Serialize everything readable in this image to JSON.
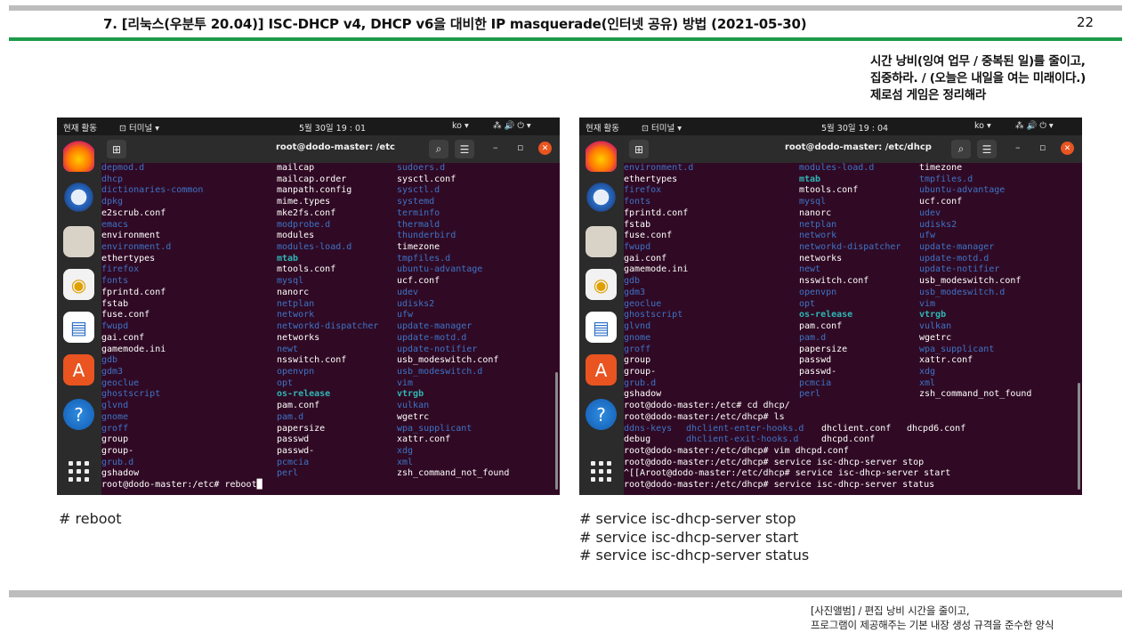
{
  "page": {
    "title": "7. [리눅스(우분투 20.04)] ISC-DHCP v4, DHCP v6을 대비한 IP masquerade(인터넷 공유) 방법 (2021-05-30)",
    "page_number": "22",
    "motto": [
      "시간 낭비(잉여 업무 / 중복된 일)를 줄이고,",
      "집중하라. / (오늘은 내일을 여는 미래이다.)",
      "제로섬 게임은 정리해라"
    ],
    "footer": [
      "[사진앨범] / 편집 낭비 시간을 줄이고,",
      "프로그램이 제공해주는 기본 내장 생성 규격을 준수한 양식"
    ]
  },
  "shots": [
    {
      "topbar": {
        "activities": "현재 활동",
        "app_menu": "⊡ 터미널 ▾",
        "clock": "5월 30일  19 : 01",
        "lang": "ko ▾",
        "sys_icons": "⁂  🔊  ⏻  ▾"
      },
      "window_title": "root@dodo-master: /etc",
      "lines": [
        [
          {
            "t": "depmod.d",
            "c": "dir"
          },
          {
            "t": "mailcap",
            "c": "plain"
          },
          {
            "t": "sudoers.d",
            "c": "dir"
          }
        ],
        [
          {
            "t": "dhcp",
            "c": "dir"
          },
          {
            "t": "mailcap.order",
            "c": "plain"
          },
          {
            "t": "sysctl.conf",
            "c": "plain"
          }
        ],
        [
          {
            "t": "dictionaries-common",
            "c": "dir"
          },
          {
            "t": "manpath.config",
            "c": "plain"
          },
          {
            "t": "sysctl.d",
            "c": "dir"
          }
        ],
        [
          {
            "t": "dpkg",
            "c": "dir"
          },
          {
            "t": "mime.types",
            "c": "plain"
          },
          {
            "t": "systemd",
            "c": "dir"
          }
        ],
        [
          {
            "t": "e2scrub.conf",
            "c": "plain"
          },
          {
            "t": "mke2fs.conf",
            "c": "plain"
          },
          {
            "t": "terminfo",
            "c": "dir"
          }
        ],
        [
          {
            "t": "emacs",
            "c": "dir"
          },
          {
            "t": "modprobe.d",
            "c": "dir"
          },
          {
            "t": "thermald",
            "c": "dir"
          }
        ],
        [
          {
            "t": "environment",
            "c": "plain"
          },
          {
            "t": "modules",
            "c": "plain"
          },
          {
            "t": "thunderbird",
            "c": "dir"
          }
        ],
        [
          {
            "t": "environment.d",
            "c": "dir"
          },
          {
            "t": "modules-load.d",
            "c": "dir"
          },
          {
            "t": "timezone",
            "c": "plain"
          }
        ],
        [
          {
            "t": "ethertypes",
            "c": "plain"
          },
          {
            "t": "mtab",
            "c": "link"
          },
          {
            "t": "tmpfiles.d",
            "c": "dir"
          }
        ],
        [
          {
            "t": "firefox",
            "c": "dir"
          },
          {
            "t": "mtools.conf",
            "c": "plain"
          },
          {
            "t": "ubuntu-advantage",
            "c": "dir"
          }
        ],
        [
          {
            "t": "fonts",
            "c": "dir"
          },
          {
            "t": "mysql",
            "c": "dir"
          },
          {
            "t": "ucf.conf",
            "c": "plain"
          }
        ],
        [
          {
            "t": "fprintd.conf",
            "c": "plain"
          },
          {
            "t": "nanorc",
            "c": "plain"
          },
          {
            "t": "udev",
            "c": "dir"
          }
        ],
        [
          {
            "t": "fstab",
            "c": "plain"
          },
          {
            "t": "netplan",
            "c": "dir"
          },
          {
            "t": "udisks2",
            "c": "dir"
          }
        ],
        [
          {
            "t": "fuse.conf",
            "c": "plain"
          },
          {
            "t": "network",
            "c": "dir"
          },
          {
            "t": "ufw",
            "c": "dir"
          }
        ],
        [
          {
            "t": "fwupd",
            "c": "dir"
          },
          {
            "t": "networkd-dispatcher",
            "c": "dir"
          },
          {
            "t": "update-manager",
            "c": "dir"
          }
        ],
        [
          {
            "t": "gai.conf",
            "c": "plain"
          },
          {
            "t": "networks",
            "c": "plain"
          },
          {
            "t": "update-motd.d",
            "c": "dir"
          }
        ],
        [
          {
            "t": "gamemode.ini",
            "c": "plain"
          },
          {
            "t": "newt",
            "c": "dir"
          },
          {
            "t": "update-notifier",
            "c": "dir"
          }
        ],
        [
          {
            "t": "gdb",
            "c": "dir"
          },
          {
            "t": "nsswitch.conf",
            "c": "plain"
          },
          {
            "t": "usb_modeswitch.conf",
            "c": "plain"
          }
        ],
        [
          {
            "t": "gdm3",
            "c": "dir"
          },
          {
            "t": "openvpn",
            "c": "dir"
          },
          {
            "t": "usb_modeswitch.d",
            "c": "dir"
          }
        ],
        [
          {
            "t": "geoclue",
            "c": "dir"
          },
          {
            "t": "opt",
            "c": "dir"
          },
          {
            "t": "vim",
            "c": "dir"
          }
        ],
        [
          {
            "t": "ghostscript",
            "c": "dir"
          },
          {
            "t": "os-release",
            "c": "link"
          },
          {
            "t": "vtrgb",
            "c": "link"
          }
        ],
        [
          {
            "t": "glvnd",
            "c": "dir"
          },
          {
            "t": "pam.conf",
            "c": "plain"
          },
          {
            "t": "vulkan",
            "c": "dir"
          }
        ],
        [
          {
            "t": "gnome",
            "c": "dir"
          },
          {
            "t": "pam.d",
            "c": "dir"
          },
          {
            "t": "wgetrc",
            "c": "plain"
          }
        ],
        [
          {
            "t": "groff",
            "c": "dir"
          },
          {
            "t": "papersize",
            "c": "plain"
          },
          {
            "t": "wpa_supplicant",
            "c": "dir"
          }
        ],
        [
          {
            "t": "group",
            "c": "plain"
          },
          {
            "t": "passwd",
            "c": "plain"
          },
          {
            "t": "xattr.conf",
            "c": "plain"
          }
        ],
        [
          {
            "t": "group-",
            "c": "plain"
          },
          {
            "t": "passwd-",
            "c": "plain"
          },
          {
            "t": "xdg",
            "c": "dir"
          }
        ],
        [
          {
            "t": "grub.d",
            "c": "dir"
          },
          {
            "t": "pcmcia",
            "c": "dir"
          },
          {
            "t": "xml",
            "c": "dir"
          }
        ],
        [
          {
            "t": "gshadow",
            "c": "plain"
          },
          {
            "t": "perl",
            "c": "dir"
          },
          {
            "t": "zsh_command_not_found",
            "c": "plain"
          }
        ],
        [
          {
            "t": "root@dodo-master:/etc# reboot█",
            "c": "plain"
          }
        ]
      ],
      "caption": [
        "# reboot"
      ]
    },
    {
      "topbar": {
        "activities": "현재 활동",
        "app_menu": "⊡ 터미널 ▾",
        "clock": "5월 30일  19 : 04",
        "lang": "ko ▾",
        "sys_icons": "⁂  🔊  ⏻  ▾"
      },
      "window_title": "root@dodo-master: /etc/dhcp",
      "lines": [
        [
          {
            "t": "environment.d",
            "c": "dir"
          },
          {
            "t": "modules-load.d",
            "c": "dir"
          },
          {
            "t": "timezone",
            "c": "plain"
          }
        ],
        [
          {
            "t": "ethertypes",
            "c": "plain"
          },
          {
            "t": "mtab",
            "c": "link"
          },
          {
            "t": "tmpfiles.d",
            "c": "dir"
          }
        ],
        [
          {
            "t": "firefox",
            "c": "dir"
          },
          {
            "t": "mtools.conf",
            "c": "plain"
          },
          {
            "t": "ubuntu-advantage",
            "c": "dir"
          }
        ],
        [
          {
            "t": "fonts",
            "c": "dir"
          },
          {
            "t": "mysql",
            "c": "dir"
          },
          {
            "t": "ucf.conf",
            "c": "plain"
          }
        ],
        [
          {
            "t": "fprintd.conf",
            "c": "plain"
          },
          {
            "t": "nanorc",
            "c": "plain"
          },
          {
            "t": "udev",
            "c": "dir"
          }
        ],
        [
          {
            "t": "fstab",
            "c": "plain"
          },
          {
            "t": "netplan",
            "c": "dir"
          },
          {
            "t": "udisks2",
            "c": "dir"
          }
        ],
        [
          {
            "t": "fuse.conf",
            "c": "plain"
          },
          {
            "t": "network",
            "c": "dir"
          },
          {
            "t": "ufw",
            "c": "dir"
          }
        ],
        [
          {
            "t": "fwupd",
            "c": "dir"
          },
          {
            "t": "networkd-dispatcher",
            "c": "dir"
          },
          {
            "t": "update-manager",
            "c": "dir"
          }
        ],
        [
          {
            "t": "gai.conf",
            "c": "plain"
          },
          {
            "t": "networks",
            "c": "plain"
          },
          {
            "t": "update-motd.d",
            "c": "dir"
          }
        ],
        [
          {
            "t": "gamemode.ini",
            "c": "plain"
          },
          {
            "t": "newt",
            "c": "dir"
          },
          {
            "t": "update-notifier",
            "c": "dir"
          }
        ],
        [
          {
            "t": "gdb",
            "c": "dir"
          },
          {
            "t": "nsswitch.conf",
            "c": "plain"
          },
          {
            "t": "usb_modeswitch.conf",
            "c": "plain"
          }
        ],
        [
          {
            "t": "gdm3",
            "c": "dir"
          },
          {
            "t": "openvpn",
            "c": "dir"
          },
          {
            "t": "usb_modeswitch.d",
            "c": "dir"
          }
        ],
        [
          {
            "t": "geoclue",
            "c": "dir"
          },
          {
            "t": "opt",
            "c": "dir"
          },
          {
            "t": "vim",
            "c": "dir"
          }
        ],
        [
          {
            "t": "ghostscript",
            "c": "dir"
          },
          {
            "t": "os-release",
            "c": "link"
          },
          {
            "t": "vtrgb",
            "c": "link"
          }
        ],
        [
          {
            "t": "glvnd",
            "c": "dir"
          },
          {
            "t": "pam.conf",
            "c": "plain"
          },
          {
            "t": "vulkan",
            "c": "dir"
          }
        ],
        [
          {
            "t": "gnome",
            "c": "dir"
          },
          {
            "t": "pam.d",
            "c": "dir"
          },
          {
            "t": "wgetrc",
            "c": "plain"
          }
        ],
        [
          {
            "t": "groff",
            "c": "dir"
          },
          {
            "t": "papersize",
            "c": "plain"
          },
          {
            "t": "wpa_supplicant",
            "c": "dir"
          }
        ],
        [
          {
            "t": "group",
            "c": "plain"
          },
          {
            "t": "passwd",
            "c": "plain"
          },
          {
            "t": "xattr.conf",
            "c": "plain"
          }
        ],
        [
          {
            "t": "group-",
            "c": "plain"
          },
          {
            "t": "passwd-",
            "c": "plain"
          },
          {
            "t": "xdg",
            "c": "dir"
          }
        ],
        [
          {
            "t": "grub.d",
            "c": "dir"
          },
          {
            "t": "pcmcia",
            "c": "dir"
          },
          {
            "t": "xml",
            "c": "dir"
          }
        ],
        [
          {
            "t": "gshadow",
            "c": "plain"
          },
          {
            "t": "perl",
            "c": "dir"
          },
          {
            "t": "zsh_command_not_found",
            "c": "plain"
          }
        ],
        [
          {
            "t": "root@dodo-master:/etc# cd dhcp/",
            "c": "plain"
          }
        ],
        [
          {
            "t": "root@dodo-master:/etc/dhcp# ls",
            "c": "plain"
          }
        ],
        [
          {
            "t": "ddns-keys",
            "c": "dir"
          },
          {
            "t": "dhclient-enter-hooks.d",
            "c": "dir"
          },
          {
            "t": "dhclient.conf",
            "c": "plain"
          },
          {
            "t": "dhcpd6.conf",
            "c": "plain"
          }
        ],
        [
          {
            "t": "debug",
            "c": "plain"
          },
          {
            "t": "dhclient-exit-hooks.d",
            "c": "dir"
          },
          {
            "t": "dhcpd.conf",
            "c": "plain"
          }
        ],
        [
          {
            "t": "root@dodo-master:/etc/dhcp# vim dhcpd.conf",
            "c": "plain"
          }
        ],
        [
          {
            "t": "root@dodo-master:/etc/dhcp# service isc-dhcp-server stop",
            "c": "plain"
          }
        ],
        [
          {
            "t": "^[[Aroot@dodo-master:/etc/dhcp# service isc-dhcp-server start",
            "c": "plain"
          }
        ],
        [
          {
            "t": "root@dodo-master:/etc/dhcp# service isc-dhcp-server status",
            "c": "plain"
          }
        ]
      ],
      "caption": [
        "# service isc-dhcp-server stop",
        "# service isc-dhcp-server start",
        "# service isc-dhcp-server status"
      ]
    }
  ],
  "dock_icons": [
    "firefox-icon",
    "thunderbird-icon",
    "files-icon",
    "rhythmbox-icon",
    "writer-icon",
    "software-center-icon",
    "help-icon",
    "show-apps-icon"
  ]
}
